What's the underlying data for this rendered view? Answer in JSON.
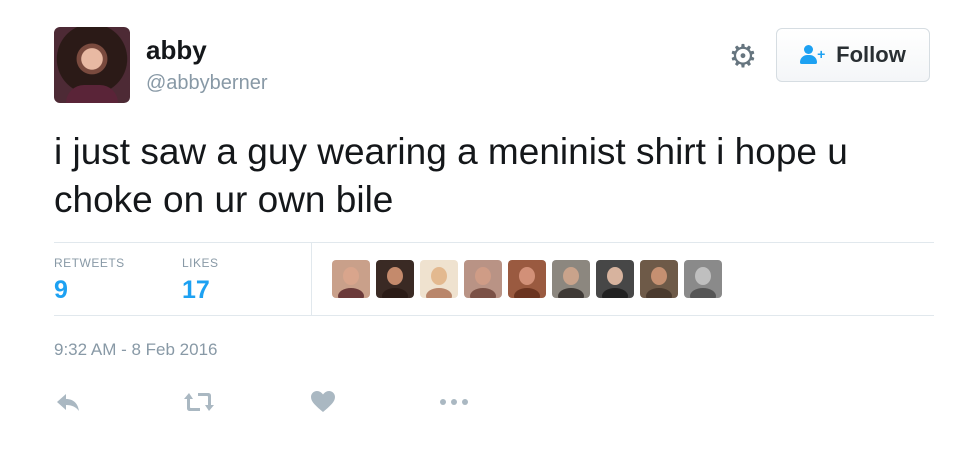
{
  "user": {
    "name": "abby",
    "handle": "@abbyberner"
  },
  "follow": {
    "label": "Follow"
  },
  "tweet": {
    "text": "i just saw a guy wearing a meninist shirt i hope u choke on ur own bile"
  },
  "stats": {
    "retweets": {
      "label": "RETWEETS",
      "count": "9"
    },
    "likes": {
      "label": "LIKES",
      "count": "17"
    }
  },
  "timestamp": "9:32 AM - 8 Feb 2016",
  "likers": [
    {
      "icon": "liker-avatar-1",
      "face": "#d9a58c",
      "shirt": "#6b3a3a",
      "bg": "#c9a08a"
    },
    {
      "icon": "liker-avatar-2",
      "face": "#c48a6c",
      "shirt": "#2b1c17",
      "bg": "#3a2a24"
    },
    {
      "icon": "liker-avatar-3",
      "face": "#e3b98f",
      "shirt": "#b9866b",
      "bg": "#efe2cf"
    },
    {
      "icon": "liker-avatar-4",
      "face": "#cf9c86",
      "shirt": "#7b5146",
      "bg": "#b99385"
    },
    {
      "icon": "liker-avatar-5",
      "face": "#d29078",
      "shirt": "#6b3420",
      "bg": "#9a5a40"
    },
    {
      "icon": "liker-avatar-6",
      "face": "#c9a38b",
      "shirt": "#3f3a36",
      "bg": "#8c877f"
    },
    {
      "icon": "liker-avatar-7",
      "face": "#d7b39e",
      "shirt": "#222222",
      "bg": "#474747"
    },
    {
      "icon": "liker-avatar-8",
      "face": "#c59071",
      "shirt": "#4a3a2e",
      "bg": "#6e5a48"
    },
    {
      "icon": "liker-avatar-9",
      "face": "#bfbfbf",
      "shirt": "#555555",
      "bg": "#8a8a8a"
    }
  ],
  "actions": [
    {
      "icon": "reply-icon"
    },
    {
      "icon": "retweet-icon"
    },
    {
      "icon": "like-icon"
    },
    {
      "icon": "more-icon"
    }
  ],
  "colors": {
    "accent": "#1da1f2",
    "muted": "#8899a6",
    "text": "#14171a"
  }
}
